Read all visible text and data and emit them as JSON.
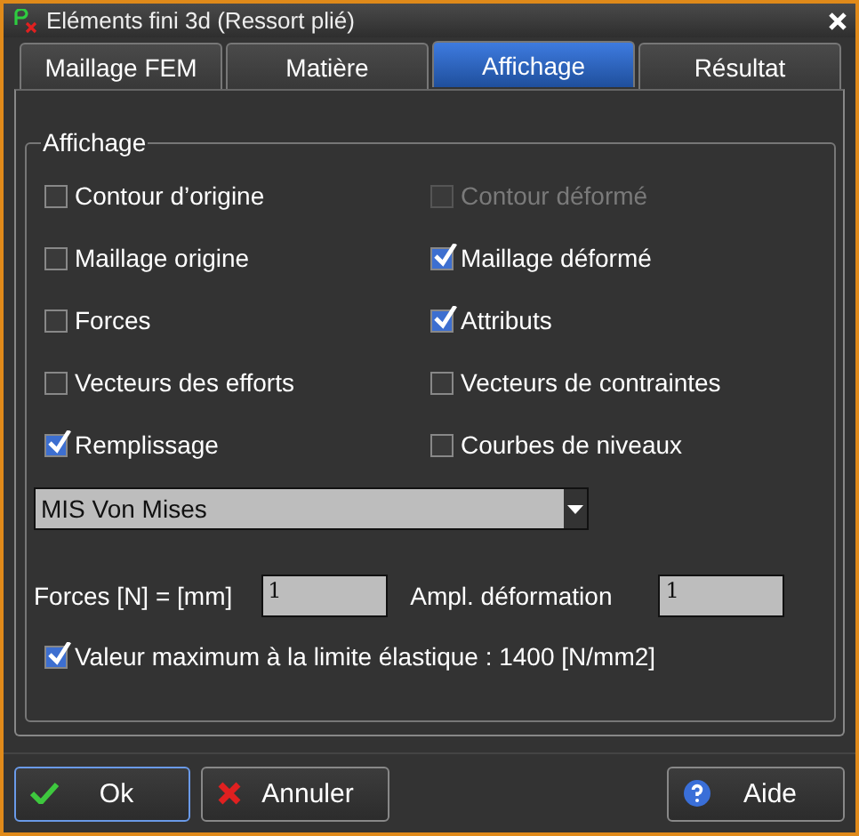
{
  "window": {
    "title": "Eléments fini 3d (Ressort plié)"
  },
  "tabs": [
    {
      "label": "Maillage FEM",
      "selected": false
    },
    {
      "label": "Matière",
      "selected": false
    },
    {
      "label": "Affichage",
      "selected": true
    },
    {
      "label": "Résultat",
      "selected": false
    }
  ],
  "group": {
    "title": "Affichage"
  },
  "options": [
    {
      "label": "Contour d’origine",
      "checked": false,
      "disabled": false
    },
    {
      "label": "Contour déformé",
      "checked": false,
      "disabled": true
    },
    {
      "label": "Maillage origine",
      "checked": false,
      "disabled": false
    },
    {
      "label": "Maillage déformé",
      "checked": true,
      "disabled": false
    },
    {
      "label": "Forces",
      "checked": false,
      "disabled": false
    },
    {
      "label": "Attributs",
      "checked": true,
      "disabled": false
    },
    {
      "label": "Vecteurs des efforts",
      "checked": false,
      "disabled": false
    },
    {
      "label": "Vecteurs de contraintes",
      "checked": false,
      "disabled": false
    },
    {
      "label": "Remplissage",
      "checked": true,
      "disabled": false
    },
    {
      "label": "Courbes de niveaux",
      "checked": false,
      "disabled": false
    }
  ],
  "result_select": {
    "value": "MIS Von Mises"
  },
  "fields": [
    {
      "label": "Forces [N] = [mm]",
      "value": "1"
    },
    {
      "label": "Ampl. déformation",
      "value": "1"
    }
  ],
  "limit_option": {
    "label": "Valeur maximum à la limite élastique : 1400 [N/mm2]",
    "checked": true
  },
  "buttons": [
    {
      "label": "Ok",
      "kind": "ok",
      "focused": true
    },
    {
      "label": "Annuler",
      "kind": "cancel",
      "focused": false
    },
    {
      "label": "Aide",
      "kind": "help",
      "focused": false
    }
  ]
}
